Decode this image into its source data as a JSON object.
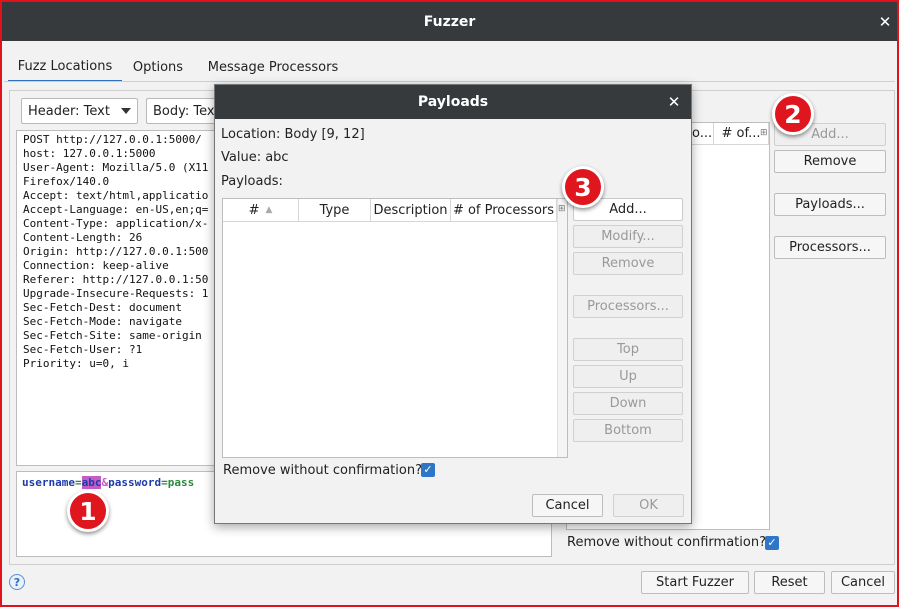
{
  "window": {
    "title": "Fuzzer"
  },
  "tabs": [
    {
      "label": "Fuzz Locations",
      "active": true
    },
    {
      "label": "Options",
      "active": false
    },
    {
      "label": "Message Processors",
      "active": false
    }
  ],
  "view": {
    "header_combo": "Header: Text",
    "body_combo": "Body: Tex"
  },
  "request": {
    "header_lines": [
      "POST http://127.0.0.1:5000/",
      "host: 127.0.0.1:5000",
      "User-Agent: Mozilla/5.0 (X11",
      "Firefox/140.0",
      "Accept: text/html,applicatio",
      "Accept-Language: en-US,en;q=",
      "Content-Type: application/x-",
      "Content-Length: 26",
      "Origin: http://127.0.0.1:500",
      "Connection: keep-alive",
      "Referer: http://127.0.0.1:50",
      "Upgrade-Insecure-Requests: 1",
      "Sec-Fetch-Dest: document",
      "Sec-Fetch-Mode: navigate",
      "Sec-Fetch-Site: same-origin",
      "Sec-Fetch-User: ?1",
      "Priority: u=0, i"
    ],
    "body": {
      "k1": "username",
      "eq": "=",
      "v1": "abc",
      "amp": "&",
      "k2": "password",
      "v2": "pass"
    }
  },
  "locations_table": {
    "col_fragment": "o...",
    "col_processors": "# of..."
  },
  "right_buttons": {
    "add": "Add...",
    "remove": "Remove",
    "payloads": "Payloads...",
    "processors": "Processors..."
  },
  "main_remove_confirm": "Remove without confirmation?",
  "footer": {
    "start": "Start Fuzzer",
    "reset": "Reset",
    "cancel": "Cancel",
    "help_glyph": "?"
  },
  "dialog": {
    "title": "Payloads",
    "location": "Location: Body [9, 12]",
    "value": "Value: abc",
    "payloads_label": "Payloads:",
    "columns": [
      "#",
      "Type",
      "Description",
      "# of Processors"
    ],
    "buttons": {
      "add": "Add...",
      "modify": "Modify...",
      "remove": "Remove",
      "processors": "Processors...",
      "top": "Top",
      "up": "Up",
      "down": "Down",
      "bottom": "Bottom"
    },
    "remove_confirm": "Remove without confirmation?",
    "cancel": "Cancel",
    "ok": "OK"
  },
  "badges": [
    "1",
    "2",
    "3"
  ],
  "colors": {
    "accent": "#2f76c9",
    "badge": "#e0161f",
    "titlebar": "#373a3d",
    "highlight": "#c35cc7"
  }
}
